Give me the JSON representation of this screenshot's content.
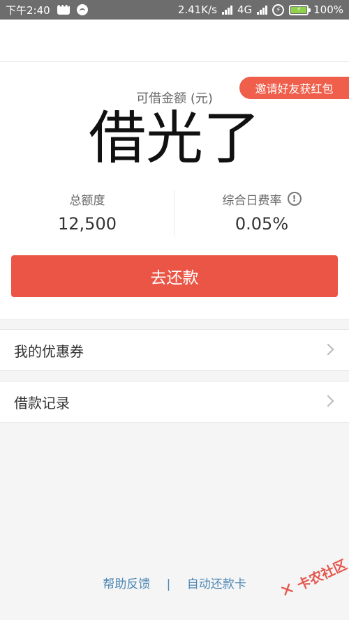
{
  "status_bar": {
    "time": "下午2:40",
    "speed": "2.41K/s",
    "network": "4G",
    "battery": "100%"
  },
  "card": {
    "invite_label": "邀请好友获红包",
    "amount_label": "可借金额 (元)",
    "amount_value": "借光了",
    "total_label": "总额度",
    "total_value": "12,500",
    "rate_label": "综合日费率",
    "rate_value": "0.05%",
    "repay_button": "去还款"
  },
  "menu": [
    {
      "label": "我的优惠券"
    },
    {
      "label": "借款记录"
    }
  ],
  "footer": {
    "help": "帮助反馈",
    "separator": "|",
    "autopay": "自动还款卡"
  },
  "watermark": {
    "text": "卡农社区"
  },
  "colors": {
    "accent": "#eb5546",
    "link": "#4e88b5",
    "status_bar": "#6d6d6d"
  }
}
